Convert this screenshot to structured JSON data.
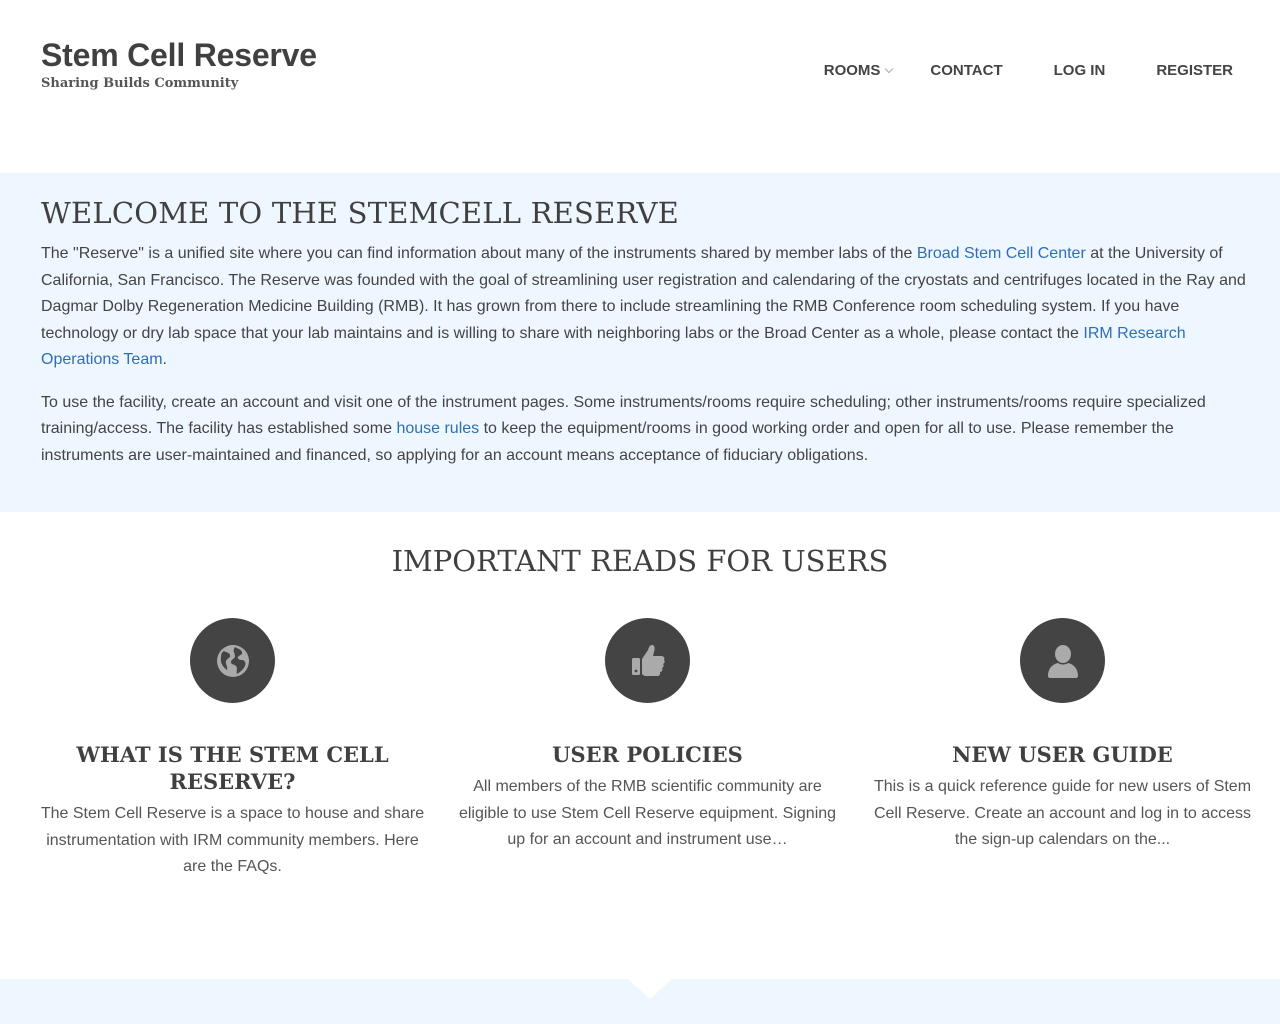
{
  "header": {
    "title": "Stem Cell Reserve",
    "tagline": "Sharing Builds Community",
    "nav": {
      "rooms": "ROOMS",
      "contact": "CONTACT",
      "login": "LOG IN",
      "register": "REGISTER"
    }
  },
  "welcome": {
    "heading": "WELCOME TO THE STEMCELL RESERVE",
    "p1_part1": "The \"Reserve\" is a unified site where you can find information about many of the instruments shared by member labs of the ",
    "p1_link1": "Broad Stem Cell Center",
    "p1_part2": " at the University of California, San Francisco. The Reserve was founded with the goal of streamlining user registration and calendaring of the cryostats and centrifuges located in the Ray and Dagmar Dolby Regeneration Medicine Building (RMB). It has grown from there to include streamlining the RMB Conference room scheduling system. If you have technology or dry lab space that your lab maintains and is willing to share with neighboring labs or the Broad Center as a whole, please contact the ",
    "p1_link2": "IRM Research Operations Team",
    "p1_part3": ".",
    "p2_part1": "To use the facility, create an account and visit one of the instrument pages. Some instruments/rooms require scheduling; other instruments/rooms require specialized training/access. The facility has established some ",
    "p2_link": "house rules",
    "p2_part2": " to keep the equipment/rooms in good working order and open for all to use. Please remember the instruments are user-maintained and financed, so applying for an account means acceptance of fiduciary obligations."
  },
  "reads": {
    "heading": "IMPORTANT READS FOR USERS",
    "cards": [
      {
        "icon": "globe-icon",
        "title": "WHAT IS THE STEM CELL RESERVE?",
        "text": "The Stem Cell Reserve is a space to house and share instrumentation with IRM community members. Here are the FAQs."
      },
      {
        "icon": "thumbs-up-icon",
        "title": "USER POLICIES",
        "text": "All members of the RMB scientific community are eligible to use Stem Cell Reserve equipment. Signing up for an account and instrument use…"
      },
      {
        "icon": "user-icon",
        "title": "NEW USER GUIDE",
        "text": "This is a quick reference guide for new users of Stem Cell Reserve. Create an account and log in to access the sign-up calendars on the..."
      }
    ]
  },
  "colors": {
    "band_background": "#eef6ff",
    "link": "#2e6fb3",
    "icon_circle": "#444444"
  }
}
